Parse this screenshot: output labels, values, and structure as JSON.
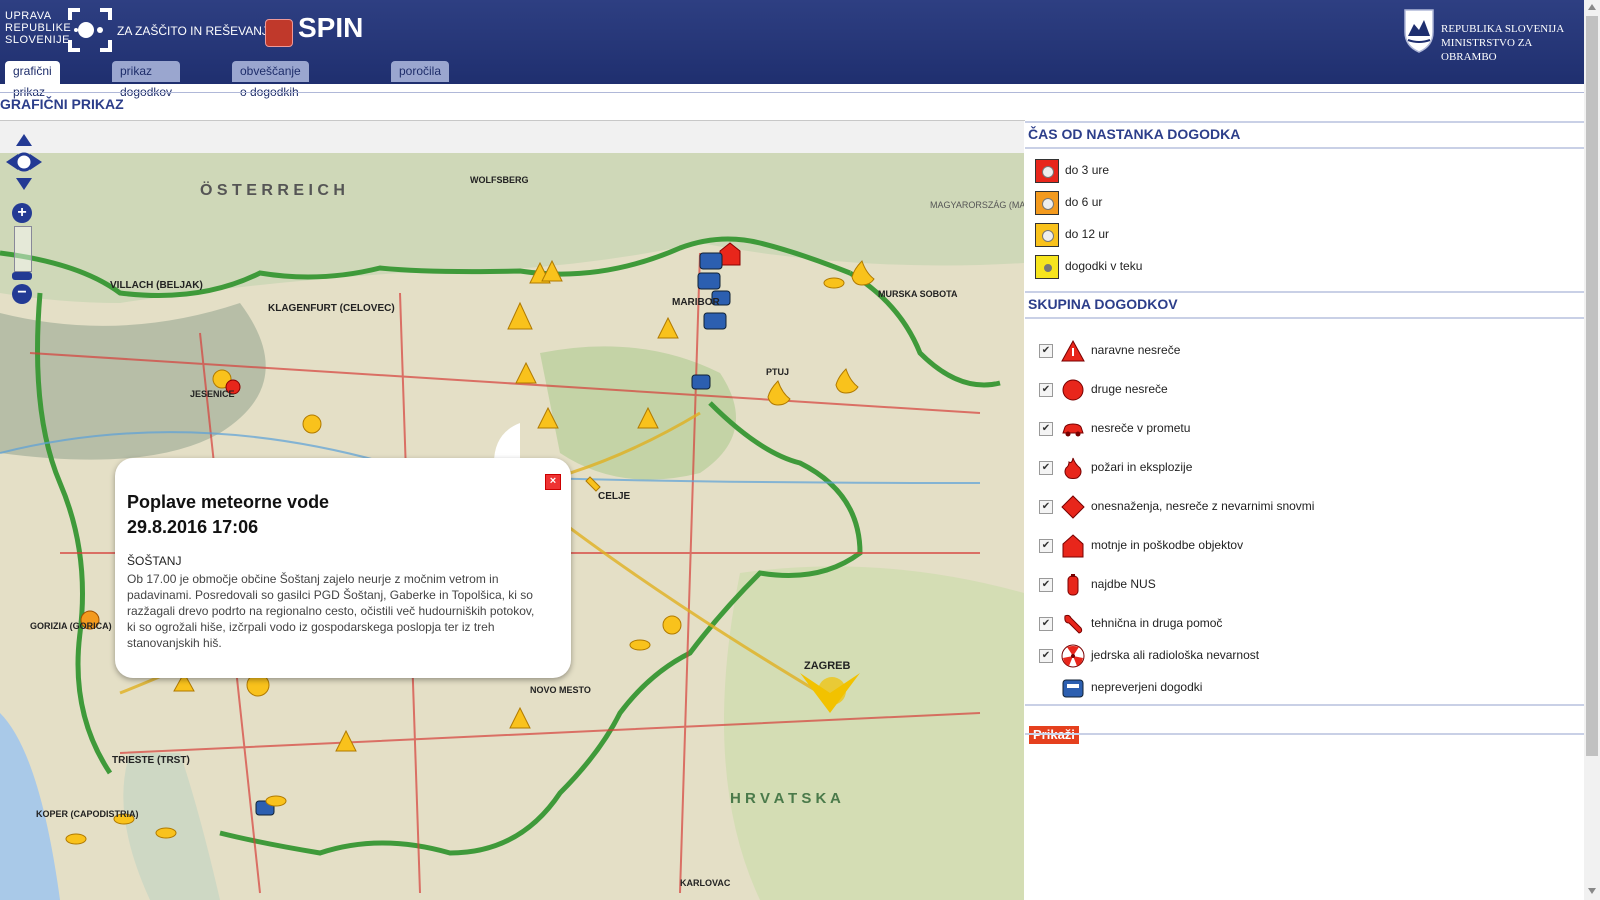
{
  "header": {
    "agency_line1": "UPRAVA",
    "agency_line2": "REPUBLIKE",
    "agency_line3": "SLOVENIJE",
    "agency_suffix": "ZA ZAŠČITO IN REŠEVANJE",
    "app_name": "SPIN",
    "ministry_line1": "REPUBLIKA SLOVENIJA",
    "ministry_line2": "MINISTRSTVO ZA OBRAMBO"
  },
  "tabs": [
    {
      "label": "grafični prikaz",
      "active": true
    },
    {
      "label": "prikaz dogodkov",
      "active": false
    },
    {
      "label": "obveščanje o dogodkih",
      "active": false
    },
    {
      "label": "poročila",
      "active": false
    }
  ],
  "page_title": "GRAFIČNI PRIKAZ",
  "popup": {
    "title": "Poplave meteorne vode",
    "datetime": "29.8.2016 17:06",
    "place": "ŠOŠTANJ",
    "body": "Ob 17.00 je območje občine Šoštanj zajelo neurje z močnim vetrom in padavinami. Posredovali so gasilci PGD Šoštanj, Gaberke in Topolšica, ki so razžagali drevo podrto na regionalno cesto, očistili več hudourniških potokov, ki so ogrožali hiše, izčrpali vodo iz gospodarskega poslopja ter iz treh stanovanjskih hiš."
  },
  "map_labels": {
    "austria": "Ö S T E R R E I C H",
    "hungary": "MAGYARORSZÁG (MADŽARSKA)",
    "croatia": "H R V A T S K A",
    "klagenfurt": "KLAGENFURT (CELOVEC)",
    "maribor": "MARIBOR",
    "celje": "CELJE",
    "zagreb": "ZAGREB",
    "trieste": "TRIESTE (TRST)",
    "villach": "VILLACH (BELJAK)",
    "wolfsberg": "WOLFSBERG",
    "murska_sobota": "MURSKA SOBOTA",
    "ptuj": "PTUJ",
    "jesenice": "JESENICE",
    "gorica": "GORIZIA (GORICA)",
    "koper": "KOPER (CAPODISTRIA)",
    "novo_mesto": "NOVO MESTO",
    "karlovac": "KARLOVAC"
  },
  "time_legend": {
    "title": "ČAS OD NASTANKA DOGODKA",
    "items": [
      {
        "label": "do 3 ure",
        "color": "#e8261b"
      },
      {
        "label": "do 6 ur",
        "color": "#f39a1e"
      },
      {
        "label": "do 12 ur",
        "color": "#f9c21c"
      },
      {
        "label": "dogodki v teku",
        "color": "#f7e51e"
      }
    ]
  },
  "groups": {
    "title": "SKUPINA DOGODKOV",
    "items": [
      {
        "label": "naravne nesreče",
        "checked": true,
        "icon": "triangle-warning-icon"
      },
      {
        "label": "druge nesreče",
        "checked": true,
        "icon": "circle-icon"
      },
      {
        "label": "nesreče v prometu",
        "checked": true,
        "icon": "car-icon"
      },
      {
        "label": "požari in eksplozije",
        "checked": true,
        "icon": "fire-icon"
      },
      {
        "label": "onesnaženja, nesreče z nevarnimi snovmi",
        "checked": true,
        "icon": "hazard-diamond-icon"
      },
      {
        "label": "motnje in poškodbe objektov",
        "checked": true,
        "icon": "house-icon"
      },
      {
        "label": "najdbe NUS",
        "checked": true,
        "icon": "bomb-icon"
      },
      {
        "label": "tehnična in druga pomoč",
        "checked": true,
        "icon": "wrench-icon"
      },
      {
        "label": "jedrska ali radiološka nevarnost",
        "checked": true,
        "icon": "radiation-icon"
      },
      {
        "label": "nepreverjeni dogodki",
        "checked": false,
        "icon": "phone-icon"
      }
    ]
  },
  "show_button": "Prikaži",
  "check_mark": "✔",
  "close_glyph": "×"
}
